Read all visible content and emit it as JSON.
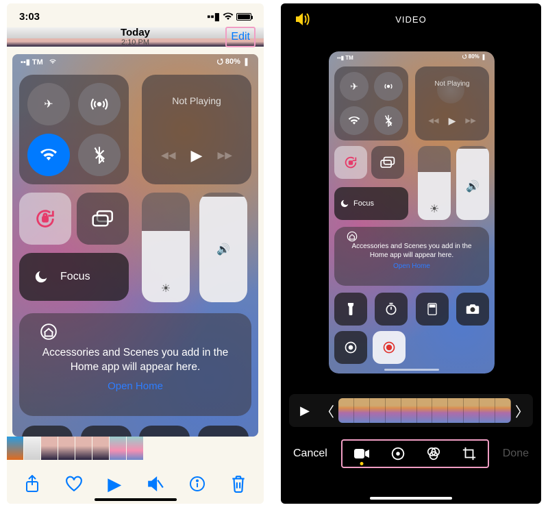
{
  "left": {
    "status_time": "3:03",
    "header_title": "Today",
    "header_subtitle": "2:10 PM",
    "edit_label": "Edit",
    "cc": {
      "carrier": "TM",
      "battery": "80%",
      "not_playing": "Not Playing",
      "focus": "Focus",
      "home_text": "Accessories and Scenes you add in the Home app will appear here.",
      "open_home": "Open Home"
    }
  },
  "right": {
    "title": "VIDEO",
    "cancel": "Cancel",
    "done": "Done",
    "cc": {
      "carrier": "TM",
      "battery": "80%",
      "not_playing": "Not Playing",
      "focus": "Focus",
      "home_text": "Accessories and Scenes you add in the Home app will appear here.",
      "open_home": "Open Home"
    }
  },
  "colors": {
    "accent": "#007aff",
    "highlight": "#f19ec4",
    "sound": "#ffcf10"
  }
}
